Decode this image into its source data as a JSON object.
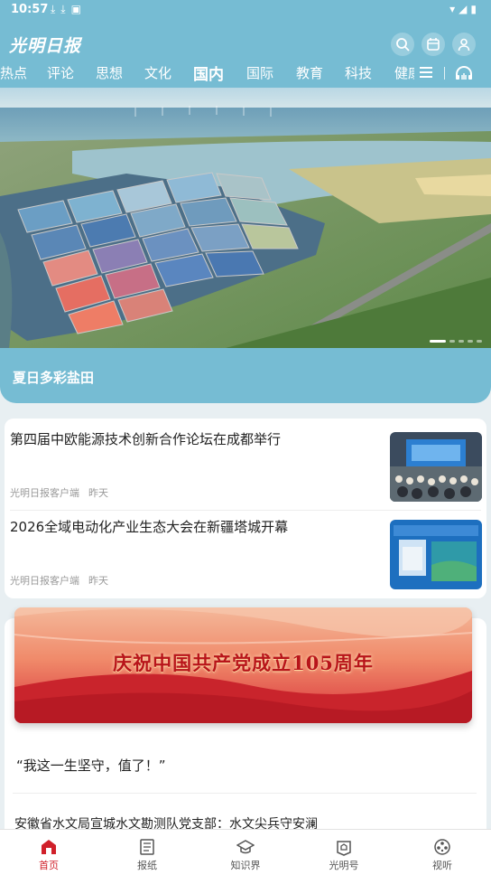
{
  "status_bar": {
    "time": "10:57"
  },
  "header": {
    "logo_text": "光明日报",
    "nav": [
      "热点",
      "评论",
      "思想",
      "文化",
      "国内",
      "国际",
      "教育",
      "科技",
      "健康"
    ],
    "active_tab": "国内"
  },
  "hero": {
    "caption": "夏日多彩盐田"
  },
  "news": [
    {
      "title": "第四届中欧能源技术创新合作论坛在成都举行",
      "source": "光明日报客户端",
      "time": "昨天"
    },
    {
      "title": "2026全域电动化产业生态大会在新疆塔城开幕",
      "source": "光明日报客户端",
      "time": "昨天"
    }
  ],
  "feature": {
    "banner_text": "庆祝中国共产党成立105周年",
    "quote": "“我这一生坚守，值了！”",
    "line2": "安徽省水文局宣城水文勘测队党支部：水文尖兵守安澜"
  },
  "bottom_nav": {
    "tabs": [
      "首页",
      "报纸",
      "知识界",
      "光明号",
      "视听"
    ],
    "active": "首页"
  },
  "colors": {
    "header": "#76bcd3",
    "accent": "#d0202a"
  }
}
